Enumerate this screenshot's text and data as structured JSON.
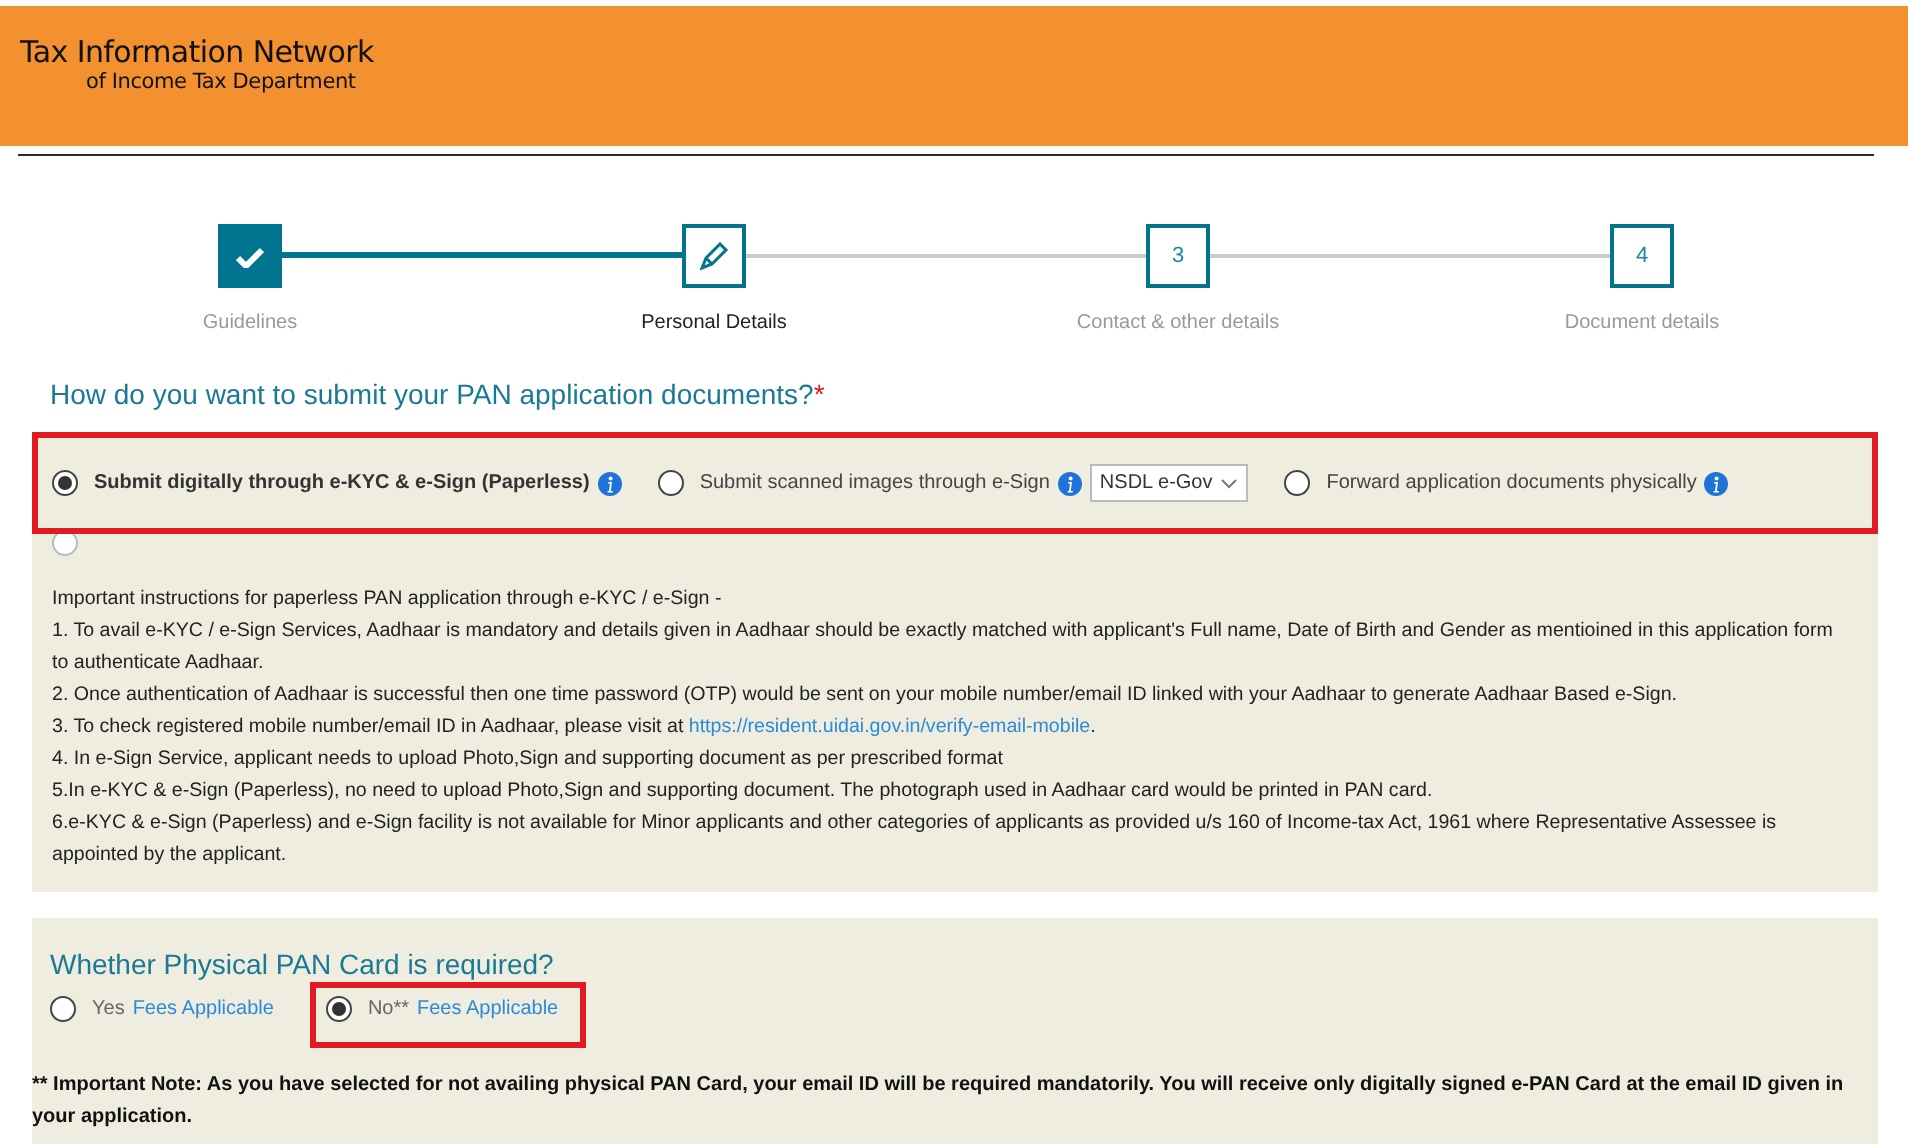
{
  "header": {
    "title": "Tax Information Network",
    "subtitle": "of Income Tax Department"
  },
  "steps": [
    {
      "label": "Guidelines",
      "kind": "done"
    },
    {
      "label": "Personal Details",
      "kind": "current"
    },
    {
      "label": "Contact & other details",
      "kind": "pending",
      "number": "3"
    },
    {
      "label": "Document details",
      "kind": "pending",
      "number": "4"
    }
  ],
  "submission": {
    "question": "How do you want to submit your PAN application documents?",
    "required_mark": "*",
    "highlighted": true,
    "options": [
      {
        "label": "Submit digitally through e-KYC & e-Sign (Paperless)",
        "selected": true
      },
      {
        "label": "Submit scanned images through e-Sign",
        "selected": false,
        "dropdown": "NSDL e-Gov"
      },
      {
        "label": "Forward application documents physically",
        "selected": false
      }
    ],
    "extra_radio": {
      "selected": false
    },
    "instructions": [
      {
        "text": "Important instructions for paperless PAN application through e-KYC / e-Sign -"
      },
      {
        "text": "1. To avail e-KYC / e-Sign Services, Aadhaar is mandatory and details given in Aadhaar should be exactly matched with applicant's Full name, Date of Birth and Gender as mentioined in this application form to authenticate Aadhaar."
      },
      {
        "text": "2. Once authentication of Aadhaar is successful then one time password (OTP) would be sent on your mobile number/email ID linked with your Aadhaar to generate Aadhaar Based e-Sign."
      },
      {
        "text": "3. To check registered mobile number/email ID in Aadhaar, please visit at ",
        "link": "https://resident.uidai.gov.in/verify-email-mobile",
        "after": "."
      },
      {
        "text": "4. In e-Sign Service, applicant needs to upload Photo,Sign and supporting document as per prescribed format"
      },
      {
        "text": "5.In e-KYC & e-Sign (Paperless), no need to upload Photo,Sign and supporting document. The photograph used in Aadhaar card would be printed in PAN card."
      },
      {
        "text": "6.e-KYC & e-Sign (Paperless) and e-Sign facility is not available for Minor applicants and other categories of applicants as provided u/s 160 of Income-tax Act, 1961 where Representative Assessee is appointed by the applicant."
      }
    ]
  },
  "physical_card": {
    "question": "Whether Physical PAN Card is required?",
    "options": [
      {
        "label": "Yes",
        "link": "Fees Applicable",
        "selected": false,
        "highlighted": false
      },
      {
        "label": "No**",
        "link": "Fees Applicable",
        "selected": true,
        "highlighted": true
      }
    ],
    "note": "** Important Note: As you have selected for not availing physical PAN Card, your email ID will be required mandatorily. You will receive only digitally signed e-PAN Card at the email ID given in your application."
  }
}
